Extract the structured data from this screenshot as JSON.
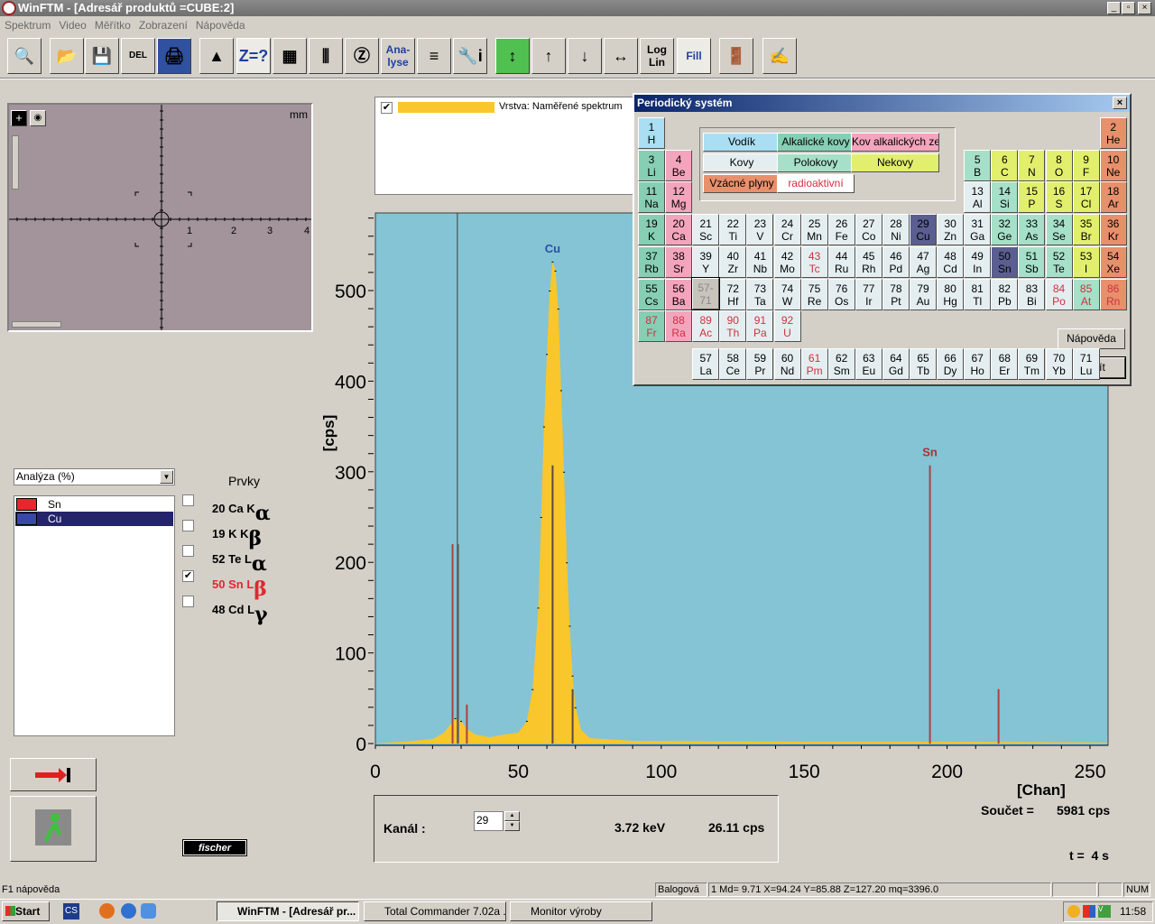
{
  "window": {
    "title": "WinFTM - [Adresář produktů =CUBE:2]",
    "controls": [
      "_",
      "▫",
      "×"
    ]
  },
  "menu": [
    "Spektrum",
    "Video",
    "Měřítko",
    "Zobrazení",
    "Nápověda"
  ],
  "toolbar": [
    {
      "name": "zoom",
      "icon": "magnifier-icon",
      "glyph": "🔍"
    },
    {
      "name": "open",
      "icon": "folder-open-icon",
      "glyph": "📂"
    },
    {
      "name": "save",
      "icon": "floppy-disk-icon",
      "glyph": "💾"
    },
    {
      "name": "delete",
      "icon": "delete-icon",
      "glyph": "DEL"
    },
    {
      "name": "print",
      "icon": "printer-icon",
      "glyph": "🖨"
    },
    {
      "name": "spectrum",
      "icon": "spectrum-icon",
      "glyph": "▲"
    },
    {
      "name": "element-id",
      "icon": "z-question-icon",
      "glyph": "Z=?"
    },
    {
      "name": "element-map",
      "icon": "z-map-icon",
      "glyph": "▦"
    },
    {
      "name": "lines",
      "icon": "spectrum-lines-icon",
      "glyph": "⫼"
    },
    {
      "name": "calibrate",
      "icon": "z-calibrate-icon",
      "glyph": "Ⓩ"
    },
    {
      "name": "analyse",
      "icon": "analyse-icon",
      "glyph": "Ana-\nlyse"
    },
    {
      "name": "layers",
      "icon": "layers-icon",
      "glyph": "≡"
    },
    {
      "name": "settings-info",
      "icon": "wrench-info-icon",
      "glyph": "🔧i"
    },
    {
      "name": "auto-scale",
      "icon": "auto-scale-icon",
      "glyph": "↕"
    },
    {
      "name": "y-scale",
      "icon": "y-scale-icon",
      "glyph": "↑"
    },
    {
      "name": "y-scale-down",
      "icon": "y-scale-down-icon",
      "glyph": "↓"
    },
    {
      "name": "x-scale",
      "icon": "x-scale-icon",
      "glyph": "↔"
    },
    {
      "name": "log-lin",
      "icon": "log-lin-icon",
      "glyph": "Log\nLin"
    },
    {
      "name": "fill",
      "icon": "fill-icon",
      "glyph": "Fill"
    },
    {
      "name": "exit",
      "icon": "door-icon",
      "glyph": "🚪"
    },
    {
      "name": "notes",
      "icon": "notepad-icon",
      "glyph": "✍"
    }
  ],
  "video": {
    "unit": "mm",
    "ticks": [
      "1",
      "2",
      "3",
      "4"
    ]
  },
  "legend": {
    "checked": true,
    "label": "Vrstva: Naměřené spektrum",
    "color": "#f9c62c"
  },
  "left": {
    "mode_select": "Analýza (%)",
    "items": [
      {
        "label": "Sn",
        "color": "#e8262e",
        "selected": false
      },
      {
        "label": "Cu",
        "color": "#3848a8",
        "selected": true
      }
    ],
    "elements_title": "Prvky",
    "lines": [
      {
        "z": "20",
        "sym": "Ca",
        "shell": "K",
        "greek": "α",
        "checked": false
      },
      {
        "z": "19",
        "sym": "K",
        "shell": "K",
        "greek": "β",
        "checked": false
      },
      {
        "z": "52",
        "sym": "Te",
        "shell": "L",
        "greek": "α",
        "checked": false
      },
      {
        "z": "50",
        "sym": "Sn",
        "shell": "L",
        "greek": "β",
        "checked": true
      },
      {
        "z": "48",
        "sym": "Cd",
        "shell": "L",
        "greek": "γ",
        "checked": false
      }
    ],
    "next_button_icon": "red-arrow-icon",
    "start_button_icon": "walking-man-icon",
    "logo": "fischer"
  },
  "chart_data": {
    "type": "area",
    "xlabel": "[Chan]",
    "ylabel": "[cps]",
    "xlim": [
      0,
      256
    ],
    "ylim": [
      0,
      580
    ],
    "xticks": [
      0,
      50,
      100,
      150,
      200,
      250
    ],
    "yticks": [
      0,
      100,
      200,
      300,
      400,
      500
    ],
    "background": "#84c4d4",
    "fill": "#f9c62c",
    "points": [
      [
        0,
        0
      ],
      [
        10,
        2
      ],
      [
        20,
        5
      ],
      [
        24,
        12
      ],
      [
        26,
        20
      ],
      [
        28,
        28
      ],
      [
        30,
        25
      ],
      [
        32,
        16
      ],
      [
        35,
        10
      ],
      [
        40,
        7
      ],
      [
        45,
        10
      ],
      [
        50,
        12
      ],
      [
        53,
        25
      ],
      [
        55,
        60
      ],
      [
        57,
        150
      ],
      [
        58,
        250
      ],
      [
        59,
        350
      ],
      [
        60,
        430
      ],
      [
        61,
        500
      ],
      [
        62,
        532
      ],
      [
        63,
        522
      ],
      [
        64,
        480
      ],
      [
        65,
        390
      ],
      [
        66,
        300
      ],
      [
        67,
        200
      ],
      [
        68,
        130
      ],
      [
        69,
        75
      ],
      [
        70,
        40
      ],
      [
        72,
        15
      ],
      [
        75,
        6
      ],
      [
        90,
        3
      ],
      [
        150,
        2
      ],
      [
        200,
        2
      ],
      [
        256,
        1
      ]
    ],
    "cursor_channel": 29,
    "markers": [
      {
        "channel": 27,
        "value": 220,
        "color": "#b04040"
      },
      {
        "channel": 29,
        "value": 220,
        "color": "#707070"
      },
      {
        "channel": 32,
        "value": 43,
        "color": "#b04040"
      },
      {
        "channel": 62,
        "value": 307,
        "color": "#604840"
      },
      {
        "channel": 69,
        "value": 60,
        "color": "#604840"
      },
      {
        "channel": 194,
        "value": 307,
        "color": "#b04040"
      },
      {
        "channel": 218,
        "value": 60,
        "color": "#b04040"
      }
    ],
    "annotations": [
      {
        "label": "Cu",
        "channel": 62,
        "value": 540,
        "color": "#2850a8"
      },
      {
        "label": "Sn",
        "channel": 194,
        "value": 315,
        "color": "#b03030"
      }
    ]
  },
  "readout": {
    "channel_label": "Kanál :",
    "channel_value": "29",
    "energy": "3.72 keV",
    "rate": "26.11 cps",
    "sum_label": "Součet =",
    "sum_value": "5981 cps",
    "time": "t =  4 s"
  },
  "periodic": {
    "title": "Periodický systém",
    "colors": {
      "vodik": "#a9def3",
      "alkali": "#86cfb5",
      "alkearth": "#f4a4bd",
      "kovy": "#e4eef0",
      "polokovy": "#a6e0c8",
      "nekovy": "#e2ef6c",
      "vzacne": "#e88f6c",
      "radio": "#ffffff",
      "selected": "#5a5e90"
    },
    "categories": [
      {
        "key": "vodik",
        "label": "Vodík"
      },
      {
        "key": "alkali",
        "label": "Alkalické kovy"
      },
      {
        "key": "alkearth",
        "label": "Kov alkalických zemin"
      },
      {
        "key": "kovy",
        "label": "Kovy"
      },
      {
        "key": "polokovy",
        "label": "Polokovy"
      },
      {
        "key": "nekovy",
        "label": "Nekovy"
      },
      {
        "key": "vzacne",
        "label": "Vzácné plyny"
      },
      {
        "key": "radio",
        "label": "radioaktivní"
      }
    ],
    "lanthanide_placeholder": "57-\n71",
    "help_button": "Nápověda",
    "close_button": "Zavřít",
    "elements": "1 H vodik;2 He vzacne;3 Li alkali;4 Be alkearth;5 B polokovy;6 C nekovy;7 N nekovy;8 O nekovy;9 F nekovy;10 Ne vzacne;11 Na alkali;12 Mg alkearth;13 Al kovy;14 Si polokovy;15 P nekovy;16 S nekovy;17 Cl nekovy;18 Ar vzacne;19 K alkali;20 Ca alkearth;21 Sc kovy;22 Ti kovy;23 V kovy;24 Cr kovy;25 Mn kovy;26 Fe kovy;27 Co kovy;28 Ni kovy;29 Cu kovy *;30 Zn kovy;31 Ga kovy;32 Ge polokovy;33 As polokovy;34 Se polokovy;35 Br nekovy;36 Kr vzacne;37 Rb alkali;38 Sr alkearth;39 Y kovy;40 Zr kovy;41 Nb kovy;42 Mo kovy;43 Tc kovy r;44 Ru kovy;45 Rh kovy;46 Pd kovy;47 Ag kovy;48 Cd kovy;49 In kovy;50 Sn kovy *;51 Sb polokovy;52 Te polokovy;53 I nekovy;54 Xe vzacne;55 Cs alkali;56 Ba alkearth;72 Hf kovy;73 Ta kovy;74 W kovy;75 Re kovy;76 Os kovy;77 Ir kovy;78 Pt kovy;79 Au kovy;80 Hg kovy;81 Tl kovy;82 Pb kovy;83 Bi kovy;84 Po kovy r;85 At polokovy r;86 Rn vzacne r;87 Fr alkali r;88 Ra alkearth r;89 Ac kovy r;90 Th kovy r;91 Pa kovy r;92 U kovy r;57 La kovy;58 Ce kovy;59 Pr kovy;60 Nd kovy;61 Pm kovy r;62 Sm kovy;63 Eu kovy;64 Gd kovy;65 Tb kovy;66 Dy kovy;67 Ho kovy;68 Er kovy;69 Tm kovy;70 Yb kovy;71 Lu kovy"
  },
  "status": {
    "hint": "F1 nápověda",
    "user": "Balogová",
    "coords": "1 Md= 9.71  X=94.24  Y=85.88  Z=127.20 mq=3396.0",
    "num": "NUM"
  },
  "taskbar": {
    "start": "Start",
    "lang": "CS",
    "tasks": [
      "WinFTM - [Adresář pr...",
      "Total Commander 7.02a ...",
      "Monitor výroby"
    ],
    "clock": "11:58"
  }
}
